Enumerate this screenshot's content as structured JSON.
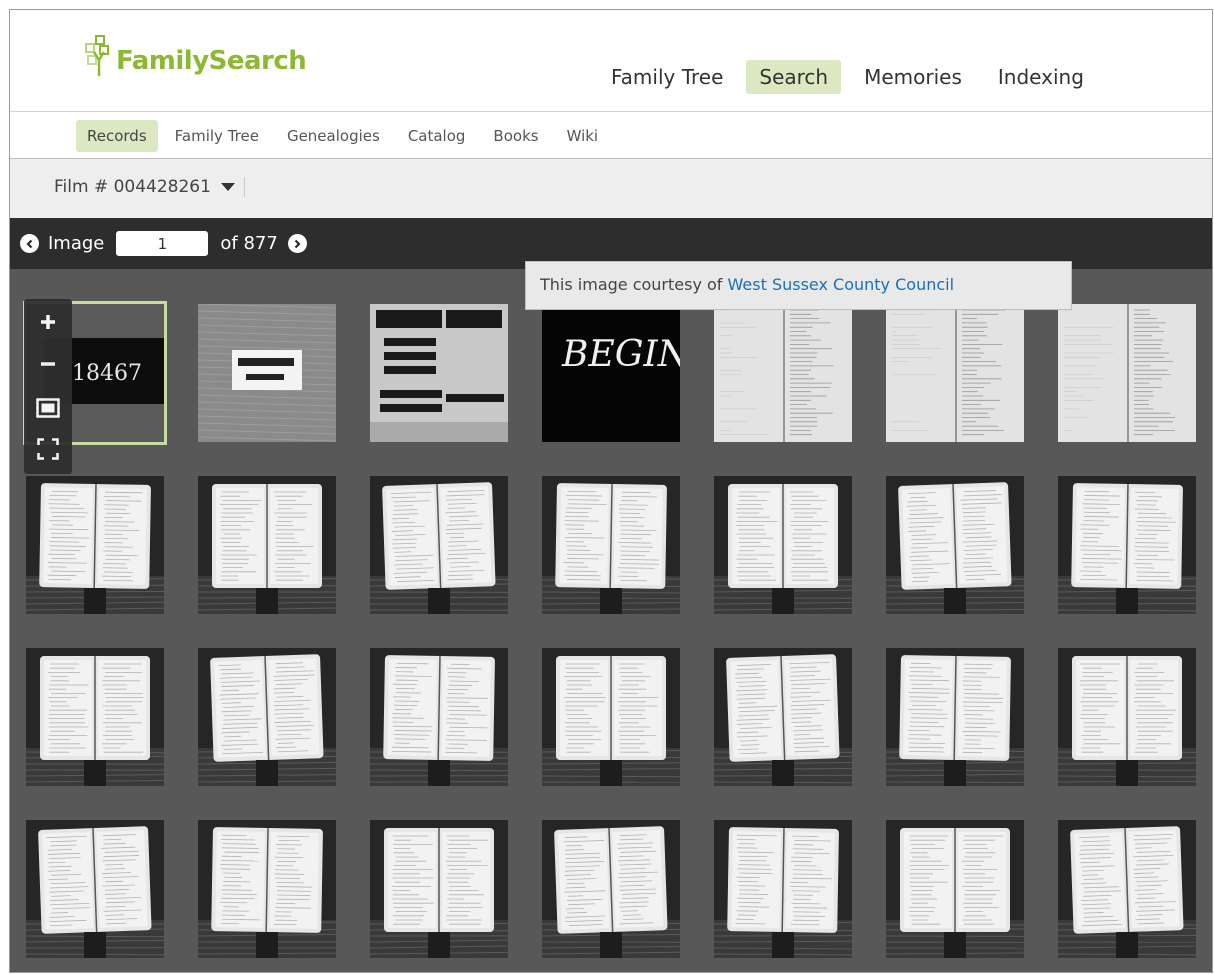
{
  "header": {
    "logo_text": "FamilySearch",
    "main_nav": [
      {
        "label": "Family Tree",
        "active": false
      },
      {
        "label": "Search",
        "active": true
      },
      {
        "label": "Memories",
        "active": false
      },
      {
        "label": "Indexing",
        "active": false
      }
    ]
  },
  "sub_nav": [
    {
      "label": "Records",
      "active": true
    },
    {
      "label": "Family Tree",
      "active": false
    },
    {
      "label": "Genealogies",
      "active": false
    },
    {
      "label": "Catalog",
      "active": false
    },
    {
      "label": "Books",
      "active": false
    },
    {
      "label": "Wiki",
      "active": false
    }
  ],
  "film": {
    "label": "Film # 004428261"
  },
  "image_nav": {
    "label": "Image",
    "current": "1",
    "of_text": "of 877"
  },
  "courtesy": {
    "prefix": "This image courtesy of",
    "link": "West Sussex County Council"
  },
  "zoom_controls": [
    "zoom-in-icon",
    "zoom-out-icon",
    "fit-screen-icon",
    "fullscreen-icon"
  ],
  "thumbnails": {
    "first_row_texts": [
      "18467",
      "BEGIN"
    ],
    "count": 28
  },
  "colors": {
    "brand_green": "#8cb832",
    "active_nav_bg": "#dbe8c2",
    "link_blue": "#1a6fb8",
    "viewer_bg": "#585858",
    "image_bar_bg": "#2d2d2d"
  }
}
